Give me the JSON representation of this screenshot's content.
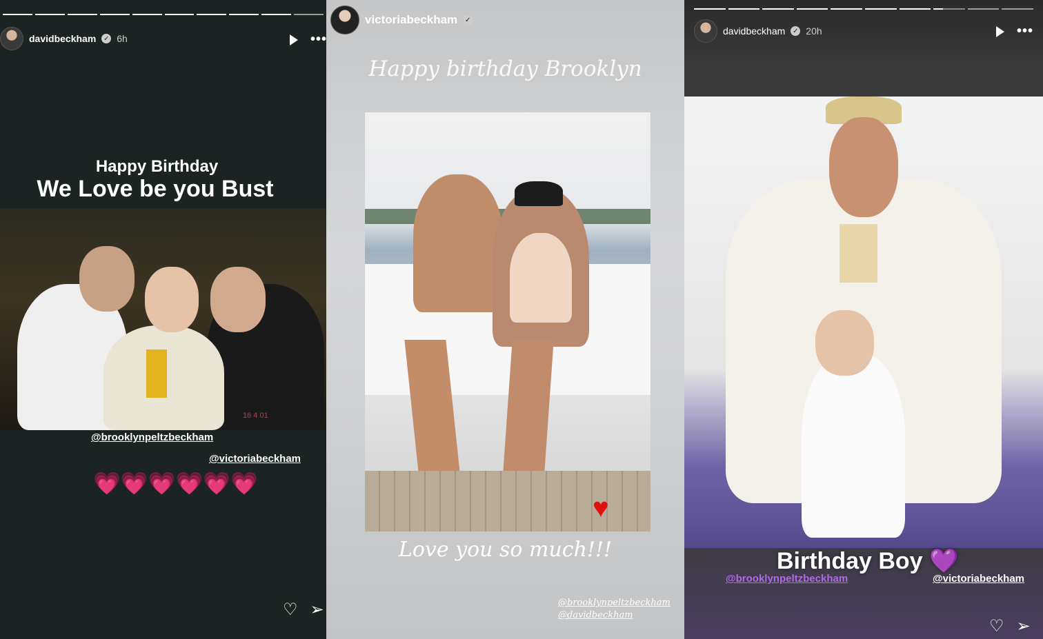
{
  "panel1": {
    "username": "davidbeckham",
    "time": "6h",
    "progress_segments": 10,
    "title_line1": "Happy Birthday",
    "title_line2": "We Love be you Bust",
    "mention1": "@brooklynpeltzbeckham",
    "mention2": "@victoriabeckham",
    "hearts": "💗💗💗💗💗💗",
    "photo_date": "16 4 01"
  },
  "panel2": {
    "username": "victoriabeckham",
    "script_title": "Happy birthday Brooklyn",
    "script_footer": "Love you so much!!!",
    "tag1": "@brooklynpeltzbeckham",
    "tag2": "@davidbeckham",
    "heart": "♥"
  },
  "panel3": {
    "username": "davidbeckham",
    "time": "20h",
    "progress_segments": 10,
    "caption": "Birthday Boy",
    "caption_heart": "💜",
    "mention1": "@brooklynpeltzbeckham",
    "mention2": "@victoriabeckham"
  },
  "icons": {
    "verified": "✓",
    "play": "play-icon",
    "more": "•••",
    "like": "♡",
    "share": "➢"
  },
  "colors": {
    "panel1_bg": "#1b2423",
    "hearts_pink": "#ff3fb4",
    "purple_heart": "#9b57e0",
    "red_heart": "#e01010"
  }
}
